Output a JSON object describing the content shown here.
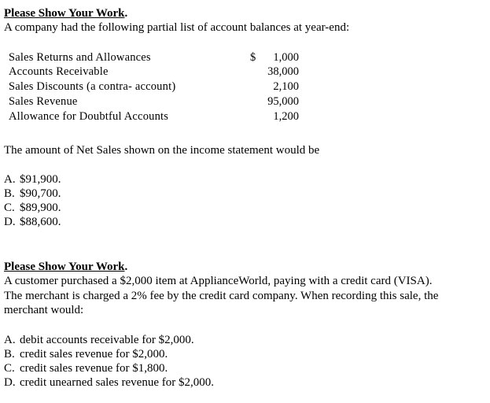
{
  "q1": {
    "title": "Please Show Your Work",
    "title_period": ".",
    "intro": "A company had the following partial list of account balances at year-end:",
    "accounts": [
      {
        "label": "Sales Returns and Allowances",
        "currency": "$",
        "value": "1,000"
      },
      {
        "label": "Accounts Receivable",
        "currency": "",
        "value": "38,000"
      },
      {
        "label": "Sales Discounts (a contra- account)",
        "currency": "",
        "value": "2,100"
      },
      {
        "label": "Sales Revenue",
        "currency": "",
        "value": "95,000"
      },
      {
        "label": "Allowance for Doubtful Accounts",
        "currency": "",
        "value": "1,200"
      }
    ],
    "question": "The amount of Net Sales shown on the income statement would be",
    "options": [
      {
        "letter": "A.",
        "text": "$91,900."
      },
      {
        "letter": "B.",
        "text": "$90,700."
      },
      {
        "letter": "C.",
        "text": "$89,900."
      },
      {
        "letter": "D.",
        "text": "$88,600."
      }
    ]
  },
  "q2": {
    "title": "Please Show Your Work",
    "title_period": ".",
    "lines": [
      "A customer purchased a $2,000 item at ApplianceWorld, paying with a credit card (VISA).",
      "The merchant is charged a 2% fee by the credit card company.  When recording this sale, the",
      "merchant would:"
    ],
    "options": [
      {
        "letter": "A.",
        "text": "debit accounts receivable for $2,000."
      },
      {
        "letter": "B.",
        "text": "credit sales revenue for $2,000."
      },
      {
        "letter": "C.",
        "text": "credit sales revenue for $1,800."
      },
      {
        "letter": "D.",
        "text": "credit unearned sales revenue for $2,000."
      }
    ]
  }
}
